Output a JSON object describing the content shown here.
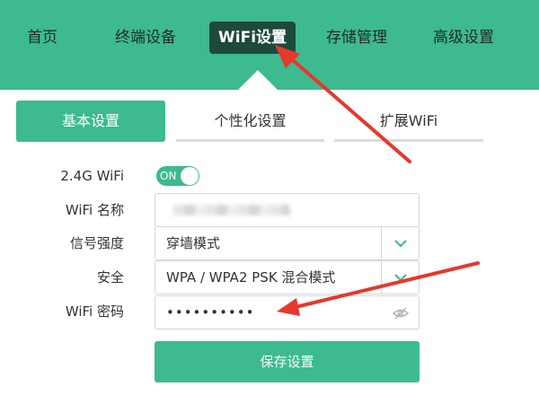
{
  "nav": {
    "items": [
      {
        "label": "首页"
      },
      {
        "label": "终端设备"
      },
      {
        "label": "WiFi设置"
      },
      {
        "label": "存储管理"
      },
      {
        "label": "高级设置"
      }
    ],
    "active_index": 2
  },
  "subtabs": {
    "items": [
      {
        "label": "基本设置"
      },
      {
        "label": "个性化设置"
      },
      {
        "label": "扩展WiFi"
      }
    ],
    "active_index": 0
  },
  "form": {
    "wifi24": {
      "label": "2.4G WiFi",
      "toggle_text": "ON",
      "state": "on"
    },
    "name": {
      "label": "WiFi 名称"
    },
    "signal": {
      "label": "信号强度",
      "value": "穿墙模式"
    },
    "security": {
      "label": "安全",
      "value": "WPA / WPA2 PSK 混合模式"
    },
    "password": {
      "label": "WiFi 密码",
      "value": "••••••••••"
    },
    "save_label": "保存设置"
  },
  "colors": {
    "accent": "#3dba8f",
    "nav_active": "#1d4a3b",
    "annotation": "#e8372c"
  },
  "icons": {
    "dropdown": "chevron-down-icon",
    "password_visibility": "eye-off-icon"
  }
}
